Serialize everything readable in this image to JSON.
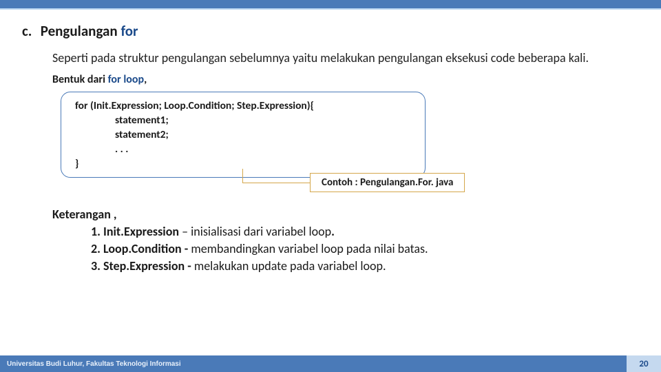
{
  "heading": {
    "marker": "c.",
    "text_before": "Pengulangan ",
    "keyword": "for"
  },
  "intro": "Seperti pada struktur pengulangan sebelumnya yaitu melakukan pengulangan eksekusi code beberapa kali.",
  "bentuk": {
    "prefix": "Bentuk dari ",
    "keyword": "for loop",
    "suffix": ","
  },
  "code": {
    "line1": "for (Init.Expression; Loop.Condition; Step.Expression){",
    "line2": "statement1;",
    "line3": "statement2;",
    "line4": ". . .",
    "line5": "}"
  },
  "contoh": "Contoh : Pengulangan.For. java",
  "ket_title": "Keterangan ,",
  "ket": [
    {
      "num": "1.",
      "term": "Init.Expression",
      "sep": " – ",
      "desc": "inisialisasi dari variabel loop",
      "end": "."
    },
    {
      "num": "2.",
      "term": "Loop.Condition",
      "sep": " - ",
      "desc": "membandingkan variabel loop pada nilai batas.",
      "end": ""
    },
    {
      "num": "3.",
      "term": "Step.Expression",
      "sep": " - ",
      "desc": "melakukan update pada variabel loop.",
      "end": ""
    }
  ],
  "footer": {
    "left": "Universitas Budi Luhur, Fakultas Teknologi Informasi",
    "page": "20"
  }
}
